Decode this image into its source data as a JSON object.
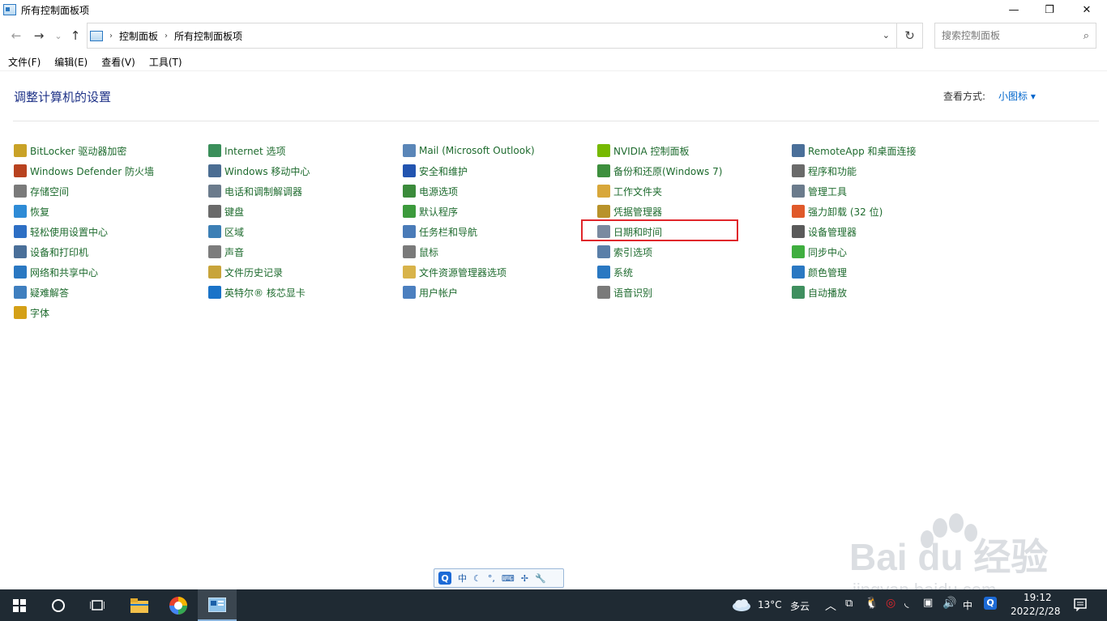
{
  "window": {
    "title": "所有控制面板项",
    "minimize": "—",
    "maximize": "❐",
    "close": "✕"
  },
  "nav": {
    "back": "←",
    "forward": "→",
    "recent": "⌄",
    "up": "↑",
    "breadcrumb": [
      "控制面板",
      "所有控制面板项"
    ],
    "search_placeholder": "搜索控制面板"
  },
  "menu": [
    "文件(F)",
    "编辑(E)",
    "查看(V)",
    "工具(T)"
  ],
  "content": {
    "heading": "调整计算机的设置",
    "view_by_label": "查看方式:",
    "view_by_value": "小图标 ▾"
  },
  "items": [
    [
      {
        "label": "BitLocker 驱动器加密",
        "icon": "bitlocker-icon",
        "color": "#c9a227"
      },
      {
        "label": "Windows Defender 防火墙",
        "icon": "firewall-icon",
        "color": "#b8421f"
      },
      {
        "label": "存储空间",
        "icon": "storage-icon",
        "color": "#7a7a7a"
      },
      {
        "label": "恢复",
        "icon": "recovery-icon",
        "color": "#2e8bd6"
      },
      {
        "label": "轻松使用设置中心",
        "icon": "ease-of-access-icon",
        "color": "#2d6fc4"
      },
      {
        "label": "设备和打印机",
        "icon": "printer-icon",
        "color": "#4a6f99"
      },
      {
        "label": "网络和共享中心",
        "icon": "network-icon",
        "color": "#2a78c2"
      },
      {
        "label": "疑难解答",
        "icon": "troubleshoot-icon",
        "color": "#3f7fbf"
      },
      {
        "label": "字体",
        "icon": "font-icon",
        "color": "#d4a017"
      }
    ],
    [
      {
        "label": "Internet 选项",
        "icon": "internet-options-icon",
        "color": "#3a8f5a"
      },
      {
        "label": "Windows 移动中心",
        "icon": "mobility-center-icon",
        "color": "#4b6d92"
      },
      {
        "label": "电话和调制解调器",
        "icon": "phone-modem-icon",
        "color": "#6b7b8c"
      },
      {
        "label": "键盘",
        "icon": "keyboard-icon",
        "color": "#6a6a6a"
      },
      {
        "label": "区域",
        "icon": "region-icon",
        "color": "#3c7fb5"
      },
      {
        "label": "声音",
        "icon": "sound-icon",
        "color": "#7c7c7c"
      },
      {
        "label": "文件历史记录",
        "icon": "file-history-icon",
        "color": "#c8a43a"
      },
      {
        "label": "英特尔® 核芯显卡",
        "icon": "intel-graphics-icon",
        "color": "#1a73c8"
      }
    ],
    [
      {
        "label": "Mail (Microsoft Outlook)",
        "icon": "mail-icon",
        "color": "#5a86b8"
      },
      {
        "label": "安全和维护",
        "icon": "security-flag-icon",
        "color": "#2254b0"
      },
      {
        "label": "电源选项",
        "icon": "power-icon",
        "color": "#3b8b3b"
      },
      {
        "label": "默认程序",
        "icon": "default-programs-icon",
        "color": "#3c9a3c"
      },
      {
        "label": "任务栏和导航",
        "icon": "taskbar-nav-icon",
        "color": "#4a7bb8"
      },
      {
        "label": "鼠标",
        "icon": "mouse-icon",
        "color": "#7a7a7a"
      },
      {
        "label": "文件资源管理器选项",
        "icon": "folder-options-icon",
        "color": "#d8b34a"
      },
      {
        "label": "用户帐户",
        "icon": "user-accounts-icon",
        "color": "#4b7fbf"
      }
    ],
    [
      {
        "label": "NVIDIA 控制面板",
        "icon": "nvidia-icon",
        "color": "#76b900"
      },
      {
        "label": "备份和还原(Windows 7)",
        "icon": "backup-icon",
        "color": "#3d8f3d"
      },
      {
        "label": "工作文件夹",
        "icon": "work-folders-icon",
        "color": "#d8a73a"
      },
      {
        "label": "凭据管理器",
        "icon": "credential-icon",
        "color": "#b8922a"
      },
      {
        "label": "日期和时间",
        "icon": "clock-icon",
        "color": "#7a8aa0"
      },
      {
        "label": "索引选项",
        "icon": "indexing-icon",
        "color": "#5a7fa8"
      },
      {
        "label": "系统",
        "icon": "system-icon",
        "color": "#2a78c2"
      },
      {
        "label": "语音识别",
        "icon": "microphone-icon",
        "color": "#7a7a7a"
      }
    ],
    [
      {
        "label": "RemoteApp 和桌面连接",
        "icon": "remoteapp-icon",
        "color": "#4a6f99"
      },
      {
        "label": "程序和功能",
        "icon": "programs-icon",
        "color": "#6a6a6a"
      },
      {
        "label": "管理工具",
        "icon": "admin-tools-icon",
        "color": "#6b7b8c"
      },
      {
        "label": "强力卸载 (32 位)",
        "icon": "uninstall-icon",
        "color": "#e0592a"
      },
      {
        "label": "设备管理器",
        "icon": "device-manager-icon",
        "color": "#5a5a5a"
      },
      {
        "label": "同步中心",
        "icon": "sync-icon",
        "color": "#3fae3f"
      },
      {
        "label": "颜色管理",
        "icon": "color-management-icon",
        "color": "#2a78c2"
      },
      {
        "label": "自动播放",
        "icon": "autoplay-icon",
        "color": "#3f8f5f"
      }
    ]
  ],
  "ime": {
    "mode": "中",
    "logo": "Q"
  },
  "taskbar": {
    "weather_temp": "13°C",
    "weather_desc": "多云",
    "ime_lang": "中",
    "time": "19:12",
    "date": "2022/2/28"
  },
  "watermark": {
    "brand": "Bai du 经验",
    "url": "jingyan.baidu.com"
  }
}
